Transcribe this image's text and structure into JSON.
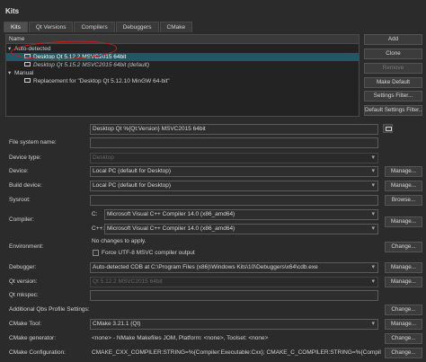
{
  "window": {
    "title": "Kits"
  },
  "tabs": [
    {
      "label": "Kits",
      "active": true
    },
    {
      "label": "Qt Versions",
      "active": false
    },
    {
      "label": "Compilers",
      "active": false
    },
    {
      "label": "Debuggers",
      "active": false
    },
    {
      "label": "CMake",
      "active": false
    }
  ],
  "tree": {
    "header": "Name",
    "groups": [
      {
        "label": "Auto-detected",
        "items": [
          {
            "label": "Desktop Qt 5.12.2 MSVC2015 64bit",
            "selected": true,
            "italic": false
          },
          {
            "label": "Desktop Qt 5.15.2 MSVC2015 64bit (default)",
            "selected": false,
            "italic": true
          }
        ]
      },
      {
        "label": "Manual",
        "items": [
          {
            "label": "Replacement for \"Desktop Qt 5.12.10 MinGW 64-bit\"",
            "selected": false,
            "italic": false
          }
        ]
      }
    ]
  },
  "side_buttons": {
    "add": "Add",
    "clone": "Clone",
    "remove": "Remove",
    "make_default": "Make Default",
    "settings_filter": "Settings Filter...",
    "default_settings_filter": "Default Settings Filter..."
  },
  "form": {
    "name_value": "Desktop Qt %{Qt:Version} MSVC2015 64bit",
    "labels": {
      "file_system_name": "File system name:",
      "device_type": "Device type:",
      "device": "Device:",
      "build_device": "Build device:",
      "sysroot": "Sysroot:",
      "compiler": "Compiler:",
      "environment": "Environment:",
      "debugger": "Debugger:",
      "qt_version": "Qt version:",
      "qt_mkspec": "Qt mkspec:",
      "additional_qbs": "Additional Qbs Profile Settings:",
      "cmake_tool": "CMake Tool:",
      "cmake_generator": "CMake generator:",
      "cmake_configuration": "CMake Configuration:"
    },
    "device_type_value": "Desktop",
    "device_value": "Local PC (default for Desktop)",
    "build_device_value": "Local PC (default for Desktop)",
    "compiler_c_label": "C:",
    "compiler_c_value": "Microsoft Visual C++ Compiler 14.0 (x86_amd64)",
    "compiler_cpp_label": "C++:",
    "compiler_cpp_value": "Microsoft Visual C++ Compiler 14.0 (x86_amd64)",
    "environment_text": "No changes to apply.",
    "force_utf8_label": "Force UTF-8 MSVC compiler output",
    "debugger_value": "Auto-detected CDB at C:\\Program Files (x86)\\Windows Kits\\10\\Debuggers\\x64\\cdb.exe",
    "qt_version_value": "Qt 5.12.2 MSVC2015 64bit",
    "cmake_tool_value": "CMake 3.21.1 (Qt)",
    "cmake_generator_value": "<none> - NMake Makefiles JOM, Platform: <none>, Toolset: <none>",
    "cmake_configuration_value": "CMAKE_CXX_COMPILER:STRING=%{Compiler:Executable:Cxx}; CMAKE_C_COMPILER:STRING=%{Compiler:Executab",
    "manage_label": "Manage...",
    "change_label": "Change...",
    "browse_label": "Browse..."
  }
}
